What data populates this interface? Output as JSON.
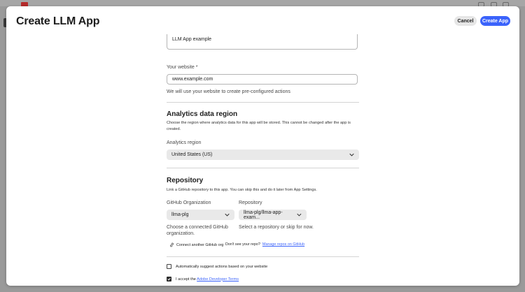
{
  "modal": {
    "title": "Create LLM App",
    "cancel_label": "Cancel",
    "create_label": "Create App"
  },
  "form": {
    "description_value": "LLM App example",
    "website": {
      "label": "Your website",
      "required_mark": "*",
      "value": "www.example.com",
      "helper": "We will use your website to create pre-configured actions"
    },
    "analytics": {
      "title": "Analytics data region",
      "description": "Choose the region where analytics data for this app will be stored. This cannot be changed after the app is created.",
      "region_label": "Analytics region",
      "region_value": "United States (US)"
    },
    "repository": {
      "title": "Repository",
      "description": "Link a GitHub repository to this app. You can skip this and do it later from App Settings.",
      "org_label": "GitHub Organization",
      "org_value": "llma-plg",
      "org_helper": "Choose a connected GitHub organization.",
      "repo_label": "Repository",
      "repo_value": "llma-plg/llma-app-exam...",
      "repo_helper": "Select a repository or skip for now.",
      "connect_label": "Connect another GitHub org",
      "missing_text": "Don't see your repo?",
      "manage_link": "Manage repos on GitHub"
    },
    "checks": {
      "suggest_label": "Automatically suggest actions based on your website",
      "suggest_checked": false,
      "terms_prefix": "I accept the",
      "terms_link": "Adobe Developer Terms",
      "terms_checked": true
    }
  },
  "colors": {
    "accent": "#3b63fb",
    "backdrop": "#9a9a9a"
  },
  "icons": {
    "select_chevron": "chevron-down-icon",
    "connect": "link-icon",
    "checkmark": "checkmark-icon"
  }
}
